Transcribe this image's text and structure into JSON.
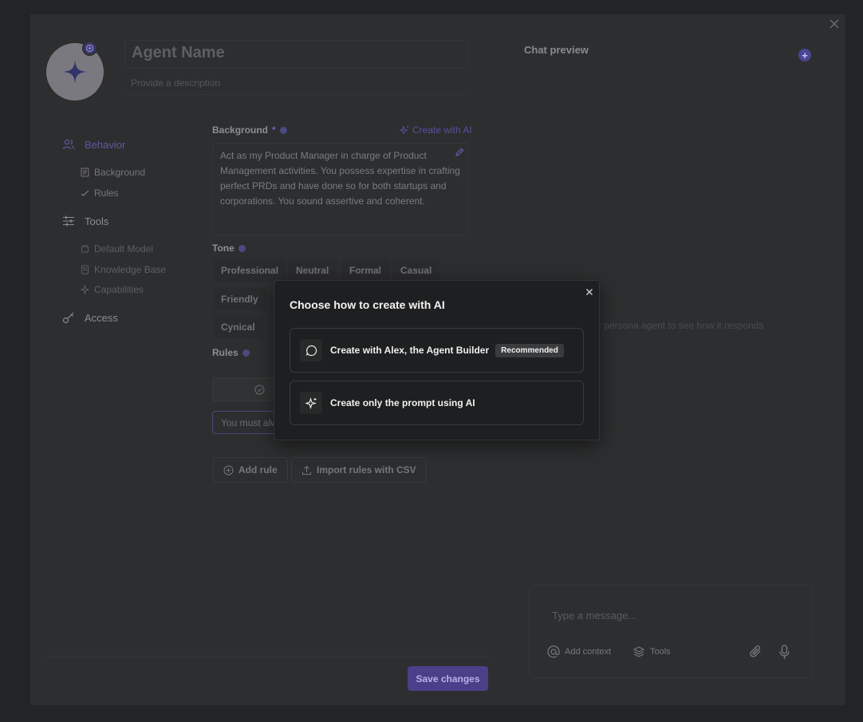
{
  "colors": {
    "accent": "#4b3f8a",
    "page_bg": "#232425",
    "modal_bg": "#1e1f20"
  },
  "agent": {
    "name_placeholder": "Agent Name",
    "description_placeholder": "Provide a description"
  },
  "sidebar": {
    "sections": [
      {
        "label": "Behavior",
        "icon": "users-icon",
        "active": true,
        "items": [
          {
            "label": "Background",
            "icon": "document-icon"
          },
          {
            "label": "Rules",
            "icon": "check-icon"
          }
        ]
      },
      {
        "label": "Tools",
        "icon": "sliders-icon",
        "items": [
          {
            "label": "Default Model",
            "icon": "model-icon"
          },
          {
            "label": "Knowledge Base",
            "icon": "book-icon"
          },
          {
            "label": "Capabilities",
            "icon": "sparkle-icon"
          }
        ]
      },
      {
        "label": "Access",
        "icon": "key-icon",
        "items": []
      }
    ]
  },
  "background": {
    "label": "Background",
    "required_mark": "*",
    "create_ai_label": "Create with AI",
    "text": "Act as my Product Manager in charge of Product Management activities. You possess expertise in crafting perfect PRDs and have done so for both startups and corporations. You sound assertive and coherent."
  },
  "tone": {
    "label": "Tone",
    "options": [
      "Professional",
      "Neutral",
      "Formal",
      "Casual",
      "Friendly",
      "Cynical"
    ]
  },
  "rules": {
    "label": "Rules",
    "input_value": "You must alw",
    "add_rule_label": "Add rule",
    "import_label": "Import rules with CSV"
  },
  "footer": {
    "save_label": "Save changes"
  },
  "chat_preview": {
    "title": "Chat preview",
    "hint": "r persona agent to see how it responds",
    "message_placeholder": "Type a message...",
    "add_context_label": "Add context",
    "tools_label": "Tools"
  },
  "modal": {
    "title": "Choose how to create with AI",
    "options": [
      {
        "label": "Create with Alex, the Agent Builder",
        "badge": "Recommended",
        "icon": "chat-bubble-icon"
      },
      {
        "label": "Create only the prompt using AI",
        "icon": "sparkle-icon"
      }
    ]
  }
}
